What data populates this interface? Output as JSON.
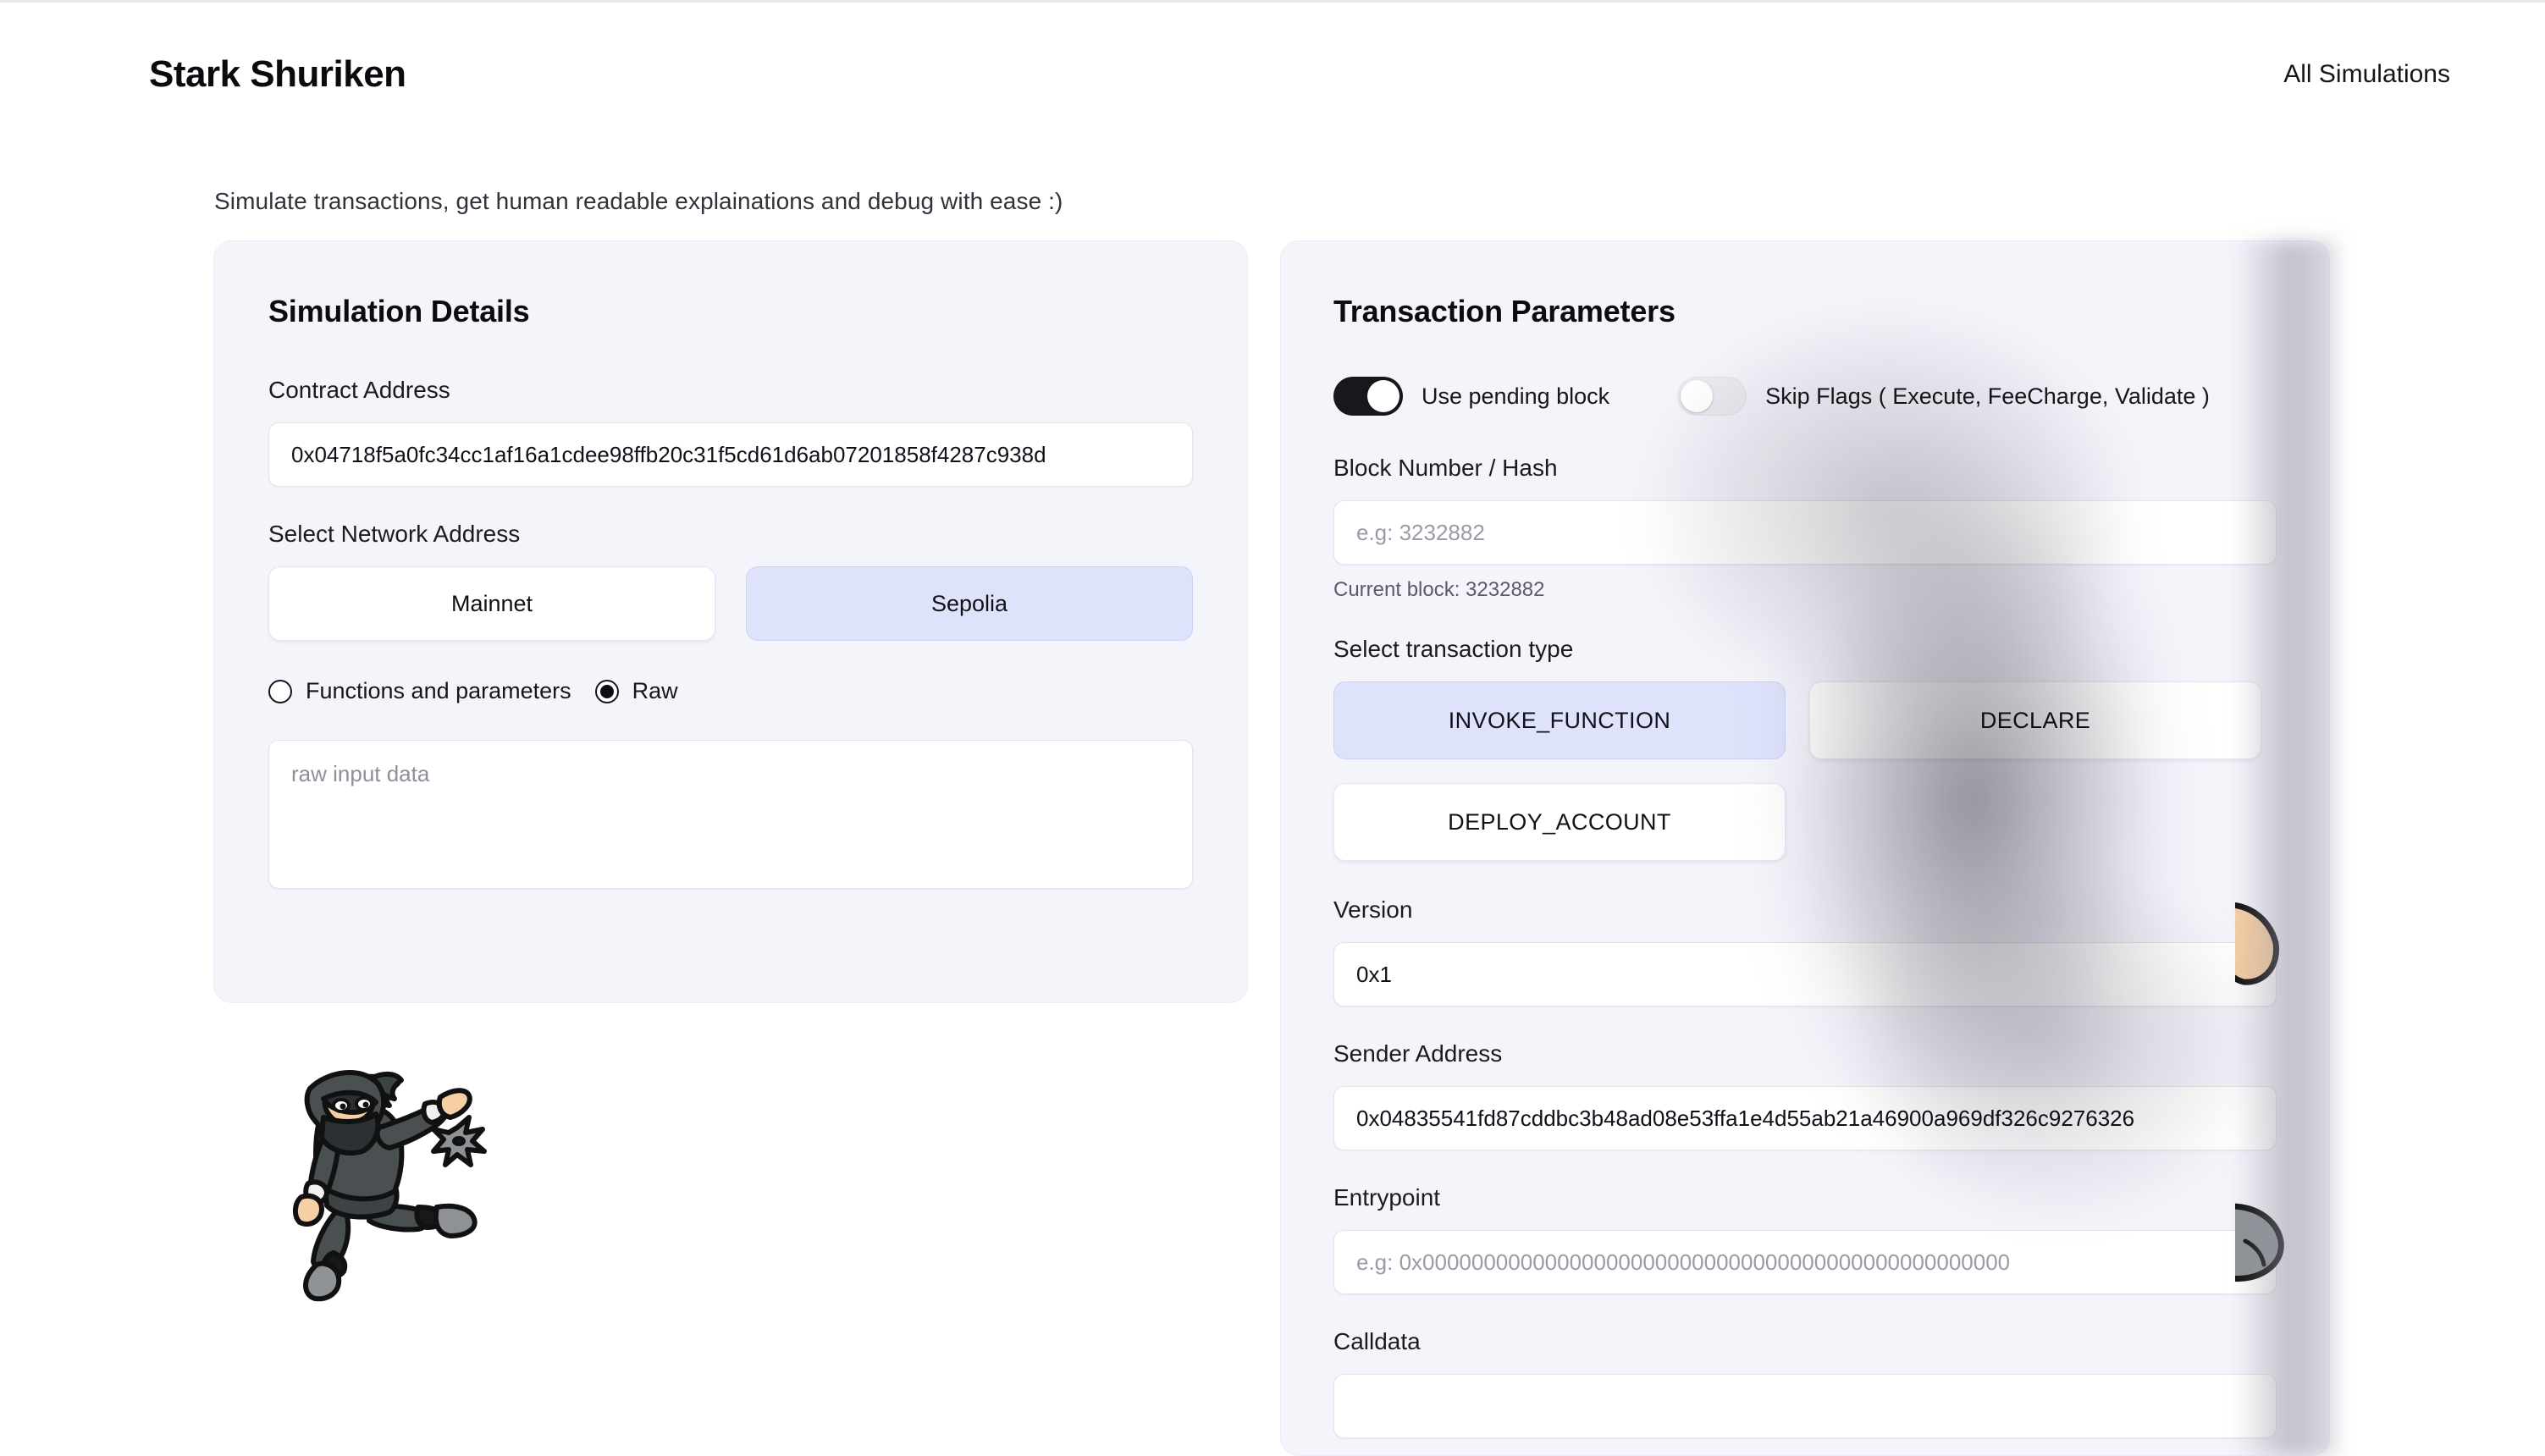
{
  "header": {
    "brand": "Stark Shuriken",
    "nav_link": "All Simulations"
  },
  "tagline": "Simulate transactions, get human readable explainations and debug with ease :)",
  "simulation_details": {
    "title": "Simulation Details",
    "contract_address_label": "Contract Address",
    "contract_address_value": "0x04718f5a0fc34cc1af16a1cdee98ffb20c31f5cd61d6ab07201858f4287c938d",
    "network_label": "Select Network Address",
    "networks": [
      {
        "label": "Mainnet",
        "selected": false
      },
      {
        "label": "Sepolia",
        "selected": true
      }
    ],
    "input_modes": [
      {
        "label": "Functions and parameters",
        "selected": false
      },
      {
        "label": "Raw",
        "selected": true
      }
    ],
    "raw_input_placeholder": "raw input data",
    "raw_input_value": ""
  },
  "transaction_parameters": {
    "title": "Transaction Parameters",
    "toggles": [
      {
        "label": "Use pending block",
        "on": true
      },
      {
        "label": "Skip Flags ( Execute, FeeCharge, Validate )",
        "on": false
      }
    ],
    "block_label": "Block Number / Hash",
    "block_placeholder": "e.g: 3232882",
    "block_value": "",
    "current_block_text": "Current block: 3232882",
    "tx_type_label": "Select transaction type",
    "tx_types": [
      {
        "label": "INVOKE_FUNCTION",
        "selected": true
      },
      {
        "label": "DECLARE",
        "selected": false
      },
      {
        "label": "DEPLOY_ACCOUNT",
        "selected": false
      }
    ],
    "version_label": "Version",
    "version_value": "0x1",
    "sender_label": "Sender Address",
    "sender_value": "0x04835541fd87cddbc3b48ad08e53ffa1e4d55ab21a46900a969df326c9276326",
    "entrypoint_label": "Entrypoint",
    "entrypoint_placeholder": "e.g: 0x000000000000000000000000000000000000000000000000",
    "entrypoint_value": "",
    "calldata_label": "Calldata",
    "calldata_value": ""
  },
  "colors": {
    "accent_selected": "#dfe2fb",
    "panel_bg": "#f4f4fb",
    "page_bg": "#ffffff",
    "toggle_on": "#17171d"
  },
  "mascot": {
    "left_alt": "ninja-throwing-shuriken",
    "right_alt": "ninja-partial-behind-panel"
  }
}
